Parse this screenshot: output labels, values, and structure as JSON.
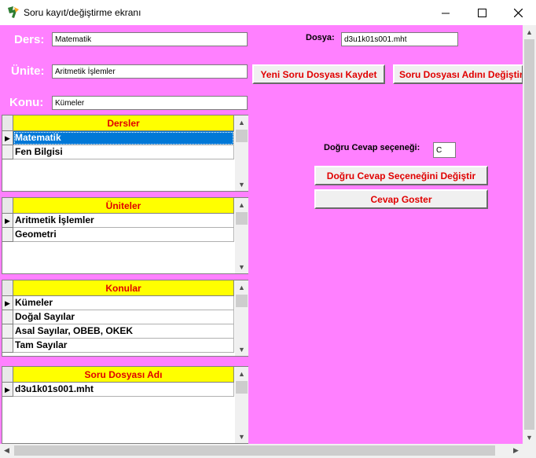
{
  "window": {
    "title": "Soru kayıt/değiştirme ekranı"
  },
  "titlebar_buttons": {
    "minimize": "—",
    "maximize": "☐",
    "close": "✕"
  },
  "form": {
    "ders_label": "Ders:",
    "ders_value": "Matematik",
    "unite_label": "Ünite:",
    "unite_value": "Aritmetik İşlemler",
    "konu_label": "Konu:",
    "konu_value": "Kümeler",
    "dosya_label": "Dosya:",
    "dosya_value": "d3u1k01s001.mht",
    "dogru_cevap_label": "Doğru Cevap seçeneği:",
    "dogru_cevap_value": "C"
  },
  "buttons": {
    "yeni_soru": "Yeni Soru Dosyası Kaydet",
    "soru_adi": "Soru Dosyası Adını Değiştir",
    "dogru_cevap_degistir": "Doğru Cevap Seçeneğini Değiştir",
    "cevap_goster": "Cevap Goster"
  },
  "grids": {
    "dersler": {
      "header": "Dersler",
      "rows": [
        "Matematik",
        "Fen Bilgisi"
      ],
      "selected_index": 0
    },
    "uniteler": {
      "header": "Üniteler",
      "rows": [
        "Aritmetik İşlemler",
        "Geometri"
      ],
      "selected_index": 0
    },
    "konular": {
      "header": "Konular",
      "rows": [
        "Kümeler",
        "Doğal Sayılar",
        "Asal Sayılar, OBEB, OKEK",
        "Tam Sayılar"
      ],
      "selected_index": 0
    },
    "soru_dosyasi": {
      "header": "Soru Dosyası Adı",
      "rows": [
        "d3u1k01s001.mht"
      ],
      "selected_index": 0
    }
  },
  "colors": {
    "background": "#ff80ff",
    "header_yellow": "#ffff00",
    "accent_red": "#e00000",
    "selection_blue": "#0078d7"
  },
  "icons": {
    "row_pointer": "▶",
    "scroll_up": "▲",
    "scroll_down": "▼",
    "scroll_left": "◀",
    "scroll_right": "▶"
  }
}
